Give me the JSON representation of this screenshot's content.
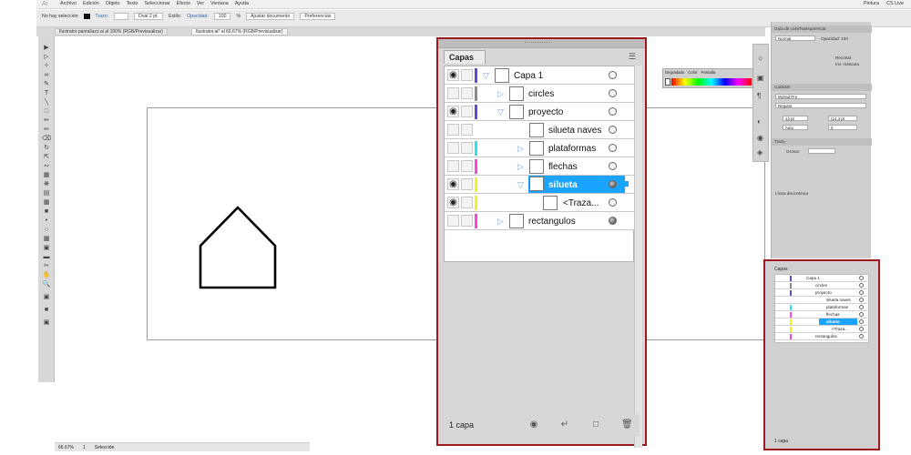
{
  "menubar": {
    "items": [
      "Archivo",
      "Edición",
      "Objeto",
      "Texto",
      "Seleccionar",
      "Efecto",
      "Ver",
      "Ventana",
      "Ayuda"
    ],
    "workspace": "Pintura",
    "cslive": "CS Live"
  },
  "controlbar": {
    "selection": "No hay selección",
    "stroke_label": "Trazo:",
    "brush": "Oval 2 pt.",
    "style_label": "Estilo:",
    "opacity_label": "Opacidad:",
    "opacity_value": "100",
    "percent": "%",
    "doc_setup": "Ajustar documento",
    "prefs": "Preferencias"
  },
  "doc_tabs": [
    {
      "label": "Ilustrator pantallazo.ai al 100% (RGB/Previsualizar)"
    },
    {
      "label": "Ilustrator.ai* al 66.67% (RGB/Previsualizar)"
    }
  ],
  "status": {
    "zoom": "66.67%",
    "page": "1",
    "tool": "Selección"
  },
  "layers_panel": {
    "tab": "Capas",
    "footer": "1 capa",
    "rows": [
      {
        "name": "Capa 1"
      },
      {
        "name": "circles"
      },
      {
        "name": "proyecto"
      },
      {
        "name": "silueta naves"
      },
      {
        "name": "plataformas"
      },
      {
        "name": "flechas"
      },
      {
        "name": "silueta"
      },
      {
        "name": "<Traza..."
      },
      {
        "name": "rectangulos"
      }
    ]
  },
  "color_panel": {
    "tabs": [
      "Degradado",
      "Color",
      "Pantalla"
    ]
  },
  "right_panels": {
    "tabs1": [
      "Guía de color",
      "Transparencia"
    ],
    "blend": "Normal",
    "opacity": "Opacidad: 100",
    "recortar": "Recortar",
    "inv": "Inv. máscara",
    "caracter": "Carácter",
    "font": "Myriad Pro",
    "style": "Regular",
    "size": "12 pt",
    "leading": "(14,4 pt",
    "auto": "Auto",
    "zero": "0",
    "trazo": "Trazo",
    "grosor": "Grosor:",
    "dashed": "Línea discontinua"
  },
  "small_layers": {
    "tab": "Capas",
    "footer": "1 capa"
  },
  "colors": {
    "blue": "#1aa3ff",
    "purple": "#5b4bd6",
    "cyan": "#28e6f0",
    "magenta": "#ff44dd",
    "yellow": "#f2f21e",
    "frame_red": "#9e1a1a"
  }
}
